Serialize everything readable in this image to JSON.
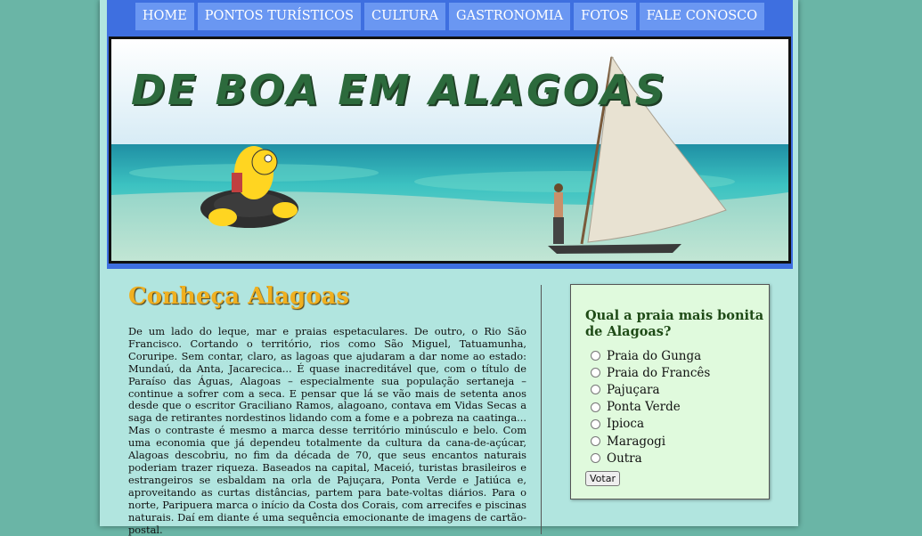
{
  "nav": {
    "items": [
      {
        "label": "HOME"
      },
      {
        "label": "PONTOS TURÍSTICOS"
      },
      {
        "label": "CULTURA"
      },
      {
        "label": "GASTRONOMIA"
      },
      {
        "label": "FOTOS"
      },
      {
        "label": "FALE CONOSCO"
      }
    ]
  },
  "banner": {
    "title": "DE BOA EM ALAGOAS"
  },
  "article": {
    "title": "Conheça Alagoas",
    "body": "De um lado do leque, mar e praias espetaculares. De outro, o Rio São Francisco. Cortando o território, rios como São Miguel, Tatuamunha, Coruripe. Sem contar, claro, as lagoas que ajudaram a dar nome ao estado: Mundaú, da Anta, Jacarecica... É quase inacreditável que, com o título de Paraíso das Águas, Alagoas – especialmente sua população sertaneja – continue a sofrer com a seca. E pensar que lá se vão mais de setenta anos desde que o escritor Graciliano Ramos, alagoano, contava em Vidas Secas a saga de retirantes nordestinos lidando com a fome e a pobreza na caatinga... Mas o contraste é mesmo a marca desse território minúsculo e belo. Com uma economia que já dependeu totalmente da cultura da cana-de-açúcar, Alagoas descobriu, no fim da década de 70, que seus encantos naturais poderiam trazer riqueza. Baseados na capital, Maceió, turistas brasileiros e estrangeiros se esbaldam na orla de Pajuçara, Ponta Verde e Jatiúca e, aproveitando as curtas distâncias, partem para bate-voltas diários. Para o norte, Paripuera marca o início da Costa dos Corais, com arrecifes e piscinas naturais. Daí em diante é uma sequência emocionante de imagens de cartão-postal."
  },
  "poll": {
    "question": "Qual a praia mais bonita de Alagoas?",
    "options": [
      {
        "label": "Praia do Gunga"
      },
      {
        "label": "Praia do Francês"
      },
      {
        "label": "Pajuçara"
      },
      {
        "label": "Ponta Verde"
      },
      {
        "label": "Ipioca"
      },
      {
        "label": "Maragogi"
      },
      {
        "label": "Outra"
      }
    ],
    "vote_label": "Votar"
  }
}
